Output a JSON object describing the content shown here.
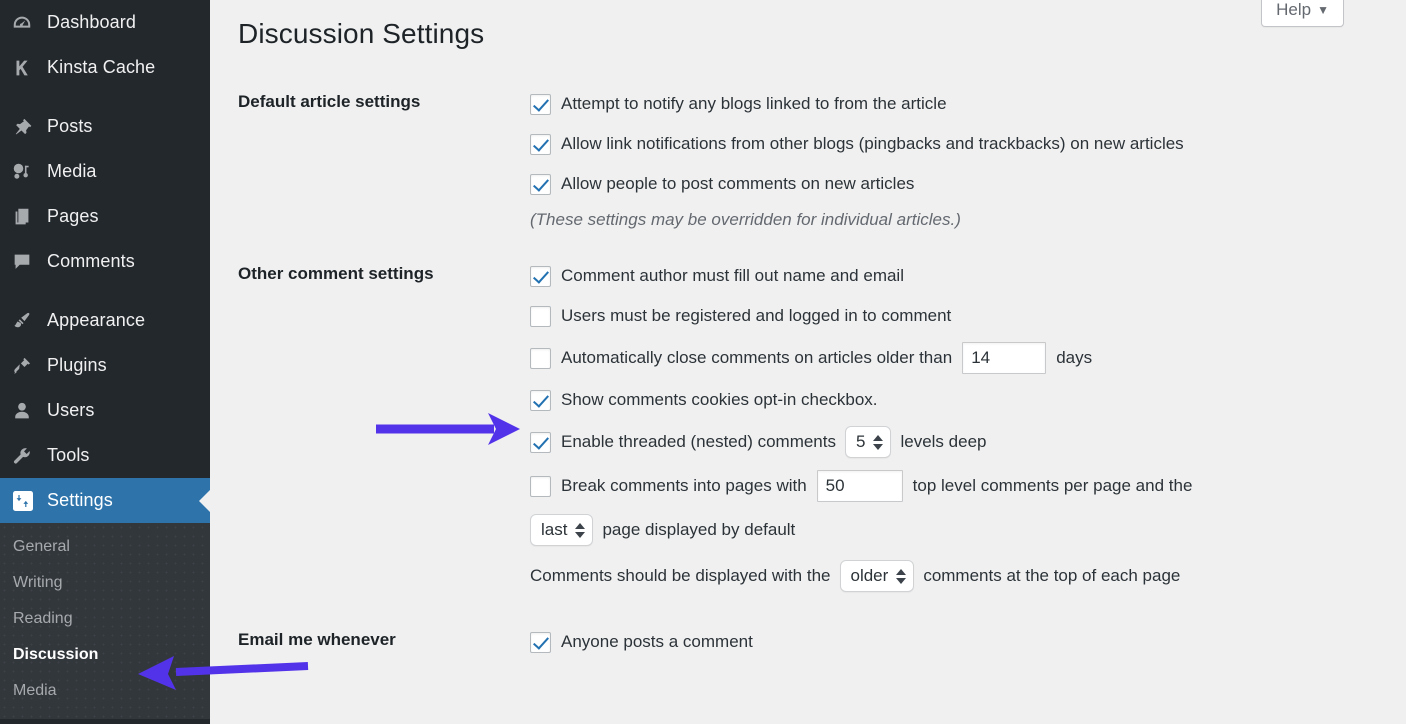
{
  "sidebar": {
    "items": [
      {
        "label": "Dashboard",
        "icon": "dashboard-icon",
        "gap": false
      },
      {
        "label": "Kinsta Cache",
        "icon": "kinsta-k-icon",
        "gap": false
      },
      {
        "label": "Posts",
        "icon": "pin-icon",
        "gap": true
      },
      {
        "label": "Media",
        "icon": "media-icon",
        "gap": false
      },
      {
        "label": "Pages",
        "icon": "pages-icon",
        "gap": false
      },
      {
        "label": "Comments",
        "icon": "comment-bubble-icon",
        "gap": false
      },
      {
        "label": "Appearance",
        "icon": "paintbrush-icon",
        "gap": true
      },
      {
        "label": "Plugins",
        "icon": "plug-icon",
        "gap": false
      },
      {
        "label": "Users",
        "icon": "user-icon",
        "gap": false
      },
      {
        "label": "Tools",
        "icon": "wrench-icon",
        "gap": false
      },
      {
        "label": "Settings",
        "icon": "sliders-icon",
        "gap": false,
        "current": true
      }
    ],
    "submenu": [
      {
        "label": "General",
        "active": false
      },
      {
        "label": "Writing",
        "active": false
      },
      {
        "label": "Reading",
        "active": false
      },
      {
        "label": "Discussion",
        "active": true
      },
      {
        "label": "Media",
        "active": false
      }
    ],
    "current_color": "#2e74ab"
  },
  "header": {
    "help_label": "Help",
    "help_caret": "▼",
    "page_title": "Discussion Settings"
  },
  "sections": {
    "default_article": {
      "heading": "Default article settings",
      "options": [
        {
          "label": "Attempt to notify any blogs linked to from the article",
          "checked": true
        },
        {
          "label": "Allow link notifications from other blogs (pingbacks and trackbacks) on new articles",
          "checked": true
        },
        {
          "label": "Allow people to post comments on new articles",
          "checked": true
        }
      ],
      "note": "(These settings may be overridden for individual articles.)"
    },
    "other_comment": {
      "heading": "Other comment settings",
      "opt_author_name_email": {
        "label": "Comment author must fill out name and email",
        "checked": true
      },
      "opt_registered": {
        "label": "Users must be registered and logged in to comment",
        "checked": false
      },
      "opt_autoclose": {
        "label_before": "Automatically close comments on articles older than",
        "value": "14",
        "label_after": "days",
        "checked": false
      },
      "opt_cookies": {
        "label": "Show comments cookies opt-in checkbox.",
        "checked": true
      },
      "opt_threaded": {
        "label_before": "Enable threaded (nested) comments",
        "value": "5",
        "label_after": "levels deep",
        "checked": true
      },
      "opt_paging": {
        "label_before": "Break comments into pages with",
        "value": "50",
        "label_after": "top level comments per page and the",
        "checked": false
      },
      "opt_page_default": {
        "select_value": "last",
        "label_after": "page displayed by default"
      },
      "opt_order": {
        "label_before": "Comments should be displayed with the",
        "select_value": "older",
        "label_after": "comments at the top of each page"
      }
    },
    "email_me": {
      "heading": "Email me whenever",
      "options": [
        {
          "label": "Anyone posts a comment",
          "checked": true
        }
      ]
    }
  },
  "annotations": {
    "arrow_color": "#5333ea",
    "arrow_to_cookies_checkbox": "right-arrow",
    "arrow_to_discussion_menu": "left-arrow"
  }
}
